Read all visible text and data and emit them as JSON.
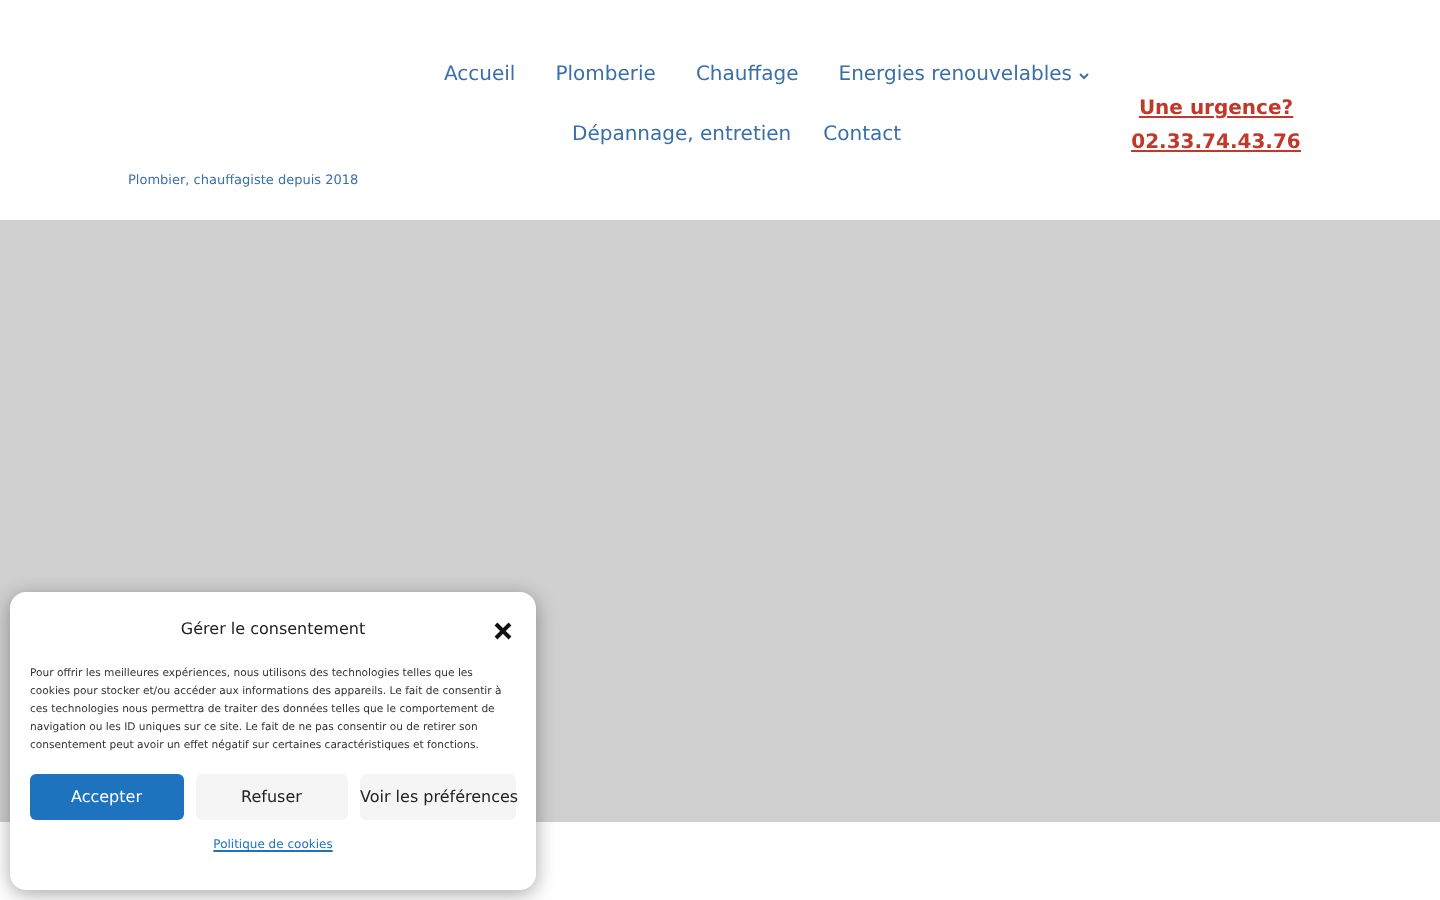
{
  "nav": [
    {
      "label": "Accueil",
      "has_submenu": false
    },
    {
      "label": "Plomberie",
      "has_submenu": false
    },
    {
      "label": "Chauffage",
      "has_submenu": false
    },
    {
      "label": "Energies renouvelables",
      "has_submenu": true
    },
    {
      "label": "Dépannage, entretien",
      "has_submenu": false
    },
    {
      "label": "Contact",
      "has_submenu": false
    }
  ],
  "tagline": "Plombier, chauffagiste depuis 2018",
  "urgent": {
    "label": "Une urgence?",
    "phone": "02.33.74.43.76"
  },
  "hero": {
    "kind": "placeholder"
  },
  "cookie_dialog": {
    "title": "Gérer le consentement",
    "text": "Pour offrir les meilleures expériences, nous utilisons des technologies telles que les cookies pour stocker et/ou accéder aux informations des appareils. Le fait de consentir à ces technologies nous permettra de traiter des données telles que le comportement de navigation ou les ID uniques sur ce site. Le fait de ne pas consentir ou de retirer son consentement peut avoir un effet négatif sur certaines caractéristiques et fonctions.",
    "buttons": [
      {
        "label": "Accepter",
        "primary": true
      },
      {
        "label": "Refuser",
        "primary": false
      },
      {
        "label": "Voir les préférences",
        "primary": false
      }
    ],
    "link": "Politique de cookies"
  }
}
